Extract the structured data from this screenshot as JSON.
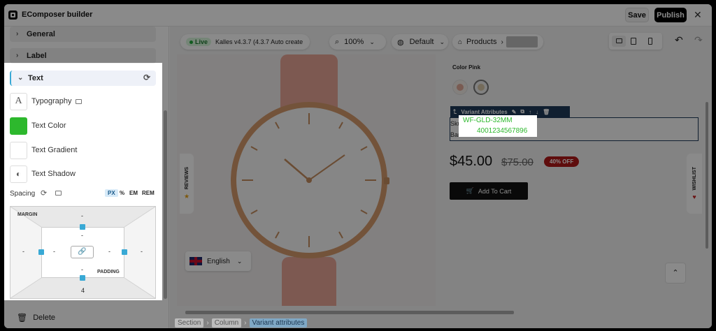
{
  "app": {
    "title": "EComposer builder",
    "save_label": "Save",
    "publish_label": "Publish"
  },
  "toolbar": {
    "live_label": "Live",
    "theme_label": "Kalles v4.3.7 (4.3.7 Auto create)",
    "zoom_value": "100%",
    "language_value": "Default",
    "page_type_label": "Products"
  },
  "sidebar": {
    "sections": [
      {
        "label": "General"
      },
      {
        "label": "Label"
      }
    ],
    "active_section": "Text",
    "properties": [
      {
        "label": "Typography",
        "icon": "A"
      },
      {
        "label": "Text Color",
        "color": "#2db82d"
      },
      {
        "label": "Text Gradient"
      },
      {
        "label": "Text Shadow"
      }
    ],
    "spacing": {
      "label": "Spacing",
      "units": [
        "PX",
        "%",
        "EM",
        "REM"
      ],
      "active_unit": "PX",
      "margin_label": "MARGIN",
      "padding_label": "PADDING",
      "margin": {
        "top": "-",
        "right": "-",
        "bottom": "4",
        "left": "-"
      },
      "padding": {
        "top": "-",
        "right": "-",
        "bottom": "-",
        "left": "-"
      }
    },
    "delete_label": "Delete"
  },
  "product": {
    "color_label": "Color",
    "color_value": "Pink",
    "variant_tool_label": "Variant Attributes",
    "sku_label": "Sku:",
    "sku_value": "WF-GLD-32MM",
    "barcode_label": "Barcode:",
    "barcode_value": "4001234567896",
    "price": "$45.00",
    "compare_price": "$75.00",
    "discount_badge": "40% OFF",
    "add_to_cart_label": "Add To Cart",
    "language_selector": "English",
    "reviews_tab": "REVIEWS",
    "wishlist_tab": "WISHLIST"
  },
  "breadcrumbs": [
    "Section",
    "Column",
    "Variant attributes"
  ],
  "colors": {
    "accent_green": "#2db82d",
    "live_green": "#22a83c",
    "selection_blue": "#39a9d5",
    "badge_red": "#b01818",
    "publish_bg": "#000000"
  }
}
